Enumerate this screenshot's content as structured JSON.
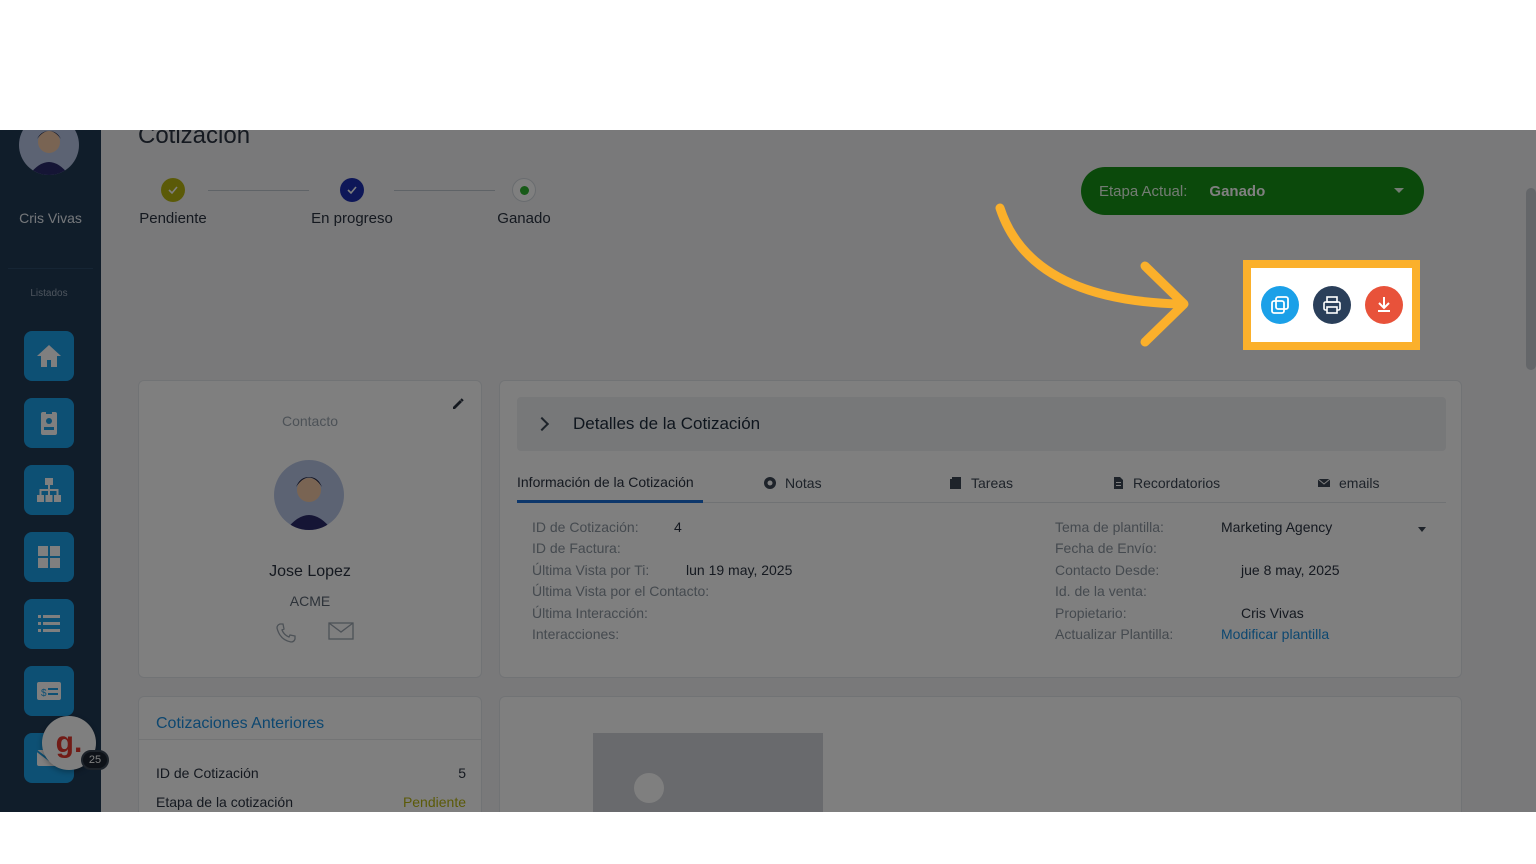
{
  "page": {
    "title": "Cotización"
  },
  "sidebar": {
    "user_name": "Cris Vivas",
    "section_label": "Listados",
    "items": [
      {
        "icon": "home-icon"
      },
      {
        "icon": "contacts-icon"
      },
      {
        "icon": "org-chart-icon"
      },
      {
        "icon": "grid-icon"
      },
      {
        "icon": "list-icon"
      },
      {
        "icon": "quote-icon"
      },
      {
        "icon": "mail-icon"
      }
    ]
  },
  "stepper": {
    "steps": [
      {
        "label": "Pendiente",
        "state": "done",
        "color": "#b7b510"
      },
      {
        "label": "En progreso",
        "state": "done",
        "color": "#1d2fb0"
      },
      {
        "label": "Ganado",
        "state": "current",
        "color": "#2fb52f"
      }
    ]
  },
  "etapa": {
    "label": "Etapa Actual:",
    "value": "Ganado",
    "color": "#169316"
  },
  "actions": {
    "highlight_color": "#fbb02b",
    "buttons": [
      {
        "name": "copy-button",
        "icon": "copy-icon",
        "color": "#1ba0e8"
      },
      {
        "name": "print-button",
        "icon": "print-icon",
        "color": "#2a3f5a"
      },
      {
        "name": "download-button",
        "icon": "download-icon",
        "color": "#e8523a"
      }
    ]
  },
  "contact": {
    "label": "Contacto",
    "name": "Jose Lopez",
    "company": "ACME"
  },
  "details": {
    "header": "Detalles de la Cotización",
    "tabs": [
      {
        "label": "Información de la Cotización",
        "active": true
      },
      {
        "label": "Notas",
        "icon": "notes-icon"
      },
      {
        "label": "Tareas",
        "icon": "tasks-icon"
      },
      {
        "label": "Recordatorios",
        "icon": "reminders-icon"
      },
      {
        "label": "emails",
        "icon": "email-icon"
      }
    ],
    "left": [
      {
        "label": "ID de Cotización:",
        "value": "4"
      },
      {
        "label": "ID de Factura:",
        "value": ""
      },
      {
        "label": "Última Vista por Ti:",
        "value": "lun 19 may, 2025"
      },
      {
        "label": "Última Vista por el Contacto:",
        "value": ""
      },
      {
        "label": "Última Interacción:",
        "value": ""
      },
      {
        "label": "Interacciones:",
        "value": ""
      }
    ],
    "right": [
      {
        "label": "Tema de plantilla:",
        "value": "Marketing Agency"
      },
      {
        "label": "Fecha de Envío:",
        "value": ""
      },
      {
        "label": "Contacto Desde:",
        "value": "jue 8 may, 2025"
      },
      {
        "label": "Id. de la venta:",
        "value": ""
      },
      {
        "label": "Propietario:",
        "value": "Cris Vivas"
      },
      {
        "label": "Actualizar Plantilla:",
        "value": "Modificar plantilla"
      }
    ]
  },
  "previous": {
    "title": "Cotizaciones Anteriores",
    "rows": [
      {
        "label": "ID de Cotización",
        "value": "5"
      },
      {
        "label": "Etapa de la cotización",
        "value": "Pendiente",
        "value_color": "#b7b510"
      }
    ]
  },
  "badge": {
    "letter": "g.",
    "count": "25"
  }
}
